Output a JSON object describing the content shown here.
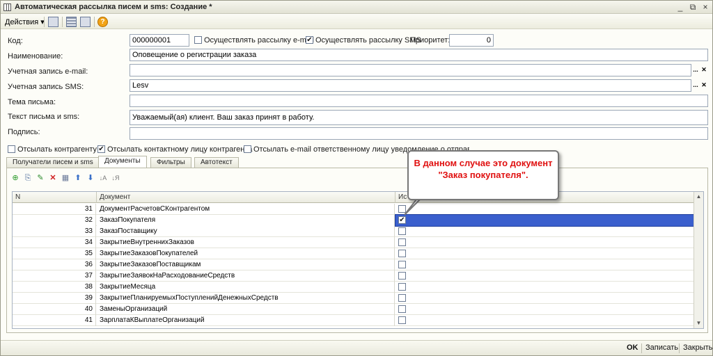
{
  "window": {
    "title": "Автоматическая рассылка писем и sms: Создание *",
    "controls": {
      "minimize": "_",
      "restore": "⧉",
      "close": "×"
    }
  },
  "toolbar": {
    "actions_label": "Действия",
    "icons": [
      "save-icon",
      "list-icon",
      "copy-icon",
      "help-icon"
    ]
  },
  "form": {
    "code_label": "Код:",
    "code_value": "000000001",
    "send_email_label": "Осуществлять рассылку e-mail",
    "send_email_checked": false,
    "send_sms_label": "Осуществлять рассылку SMS",
    "send_sms_checked": true,
    "priority_label": "Приоритет:",
    "priority_value": "0",
    "name_label": "Наименование:",
    "name_value": "Оповещение о регистрации заказа",
    "email_account_label": "Учетная запись e-mail:",
    "email_account_value": "",
    "sms_account_label": "Учетная запись SMS:",
    "sms_account_value": "Lesv",
    "subject_label": "Тема письма:",
    "subject_value": "",
    "text_label": "Текст письма и sms:",
    "text_value": "Уважаемый(ая) клиент. Ваш заказ принят в работу.",
    "signature_label": "Подпись:",
    "signature_value": "",
    "send_to_contractor_label": "Отсылать контрагенту",
    "send_to_contractor_checked": false,
    "send_to_contact_label": "Отсылать контактному лицу контрагента",
    "send_to_contact_checked": true,
    "send_to_responsible_label": "Отсылать e-mail ответственному лицу уведомление о отправленных"
  },
  "tabs": [
    {
      "label": "Получатели писем и sms",
      "active": false
    },
    {
      "label": "Документы",
      "active": true
    },
    {
      "label": "Фильтры",
      "active": false
    },
    {
      "label": "Автотекст",
      "active": false
    }
  ],
  "table": {
    "columns": [
      "N",
      "Документ",
      "Ис"
    ],
    "rows": [
      {
        "n": "31",
        "doc": "ДокументРасчетовСКонтрагентом",
        "use": false
      },
      {
        "n": "32",
        "doc": "ЗаказПокупателя",
        "use": true
      },
      {
        "n": "33",
        "doc": "ЗаказПоставщику",
        "use": false
      },
      {
        "n": "34",
        "doc": "ЗакрытиеВнутреннихЗаказов",
        "use": false
      },
      {
        "n": "35",
        "doc": "ЗакрытиеЗаказовПокупателей",
        "use": false
      },
      {
        "n": "36",
        "doc": "ЗакрытиеЗаказовПоставщикам",
        "use": false
      },
      {
        "n": "37",
        "doc": "ЗакрытиеЗаявокНаРасходованиеСредств",
        "use": false
      },
      {
        "n": "38",
        "doc": "ЗакрытиеМесяца",
        "use": false
      },
      {
        "n": "39",
        "doc": "ЗакрытиеПланируемыхПоступленийДенежныхСредств",
        "use": false
      },
      {
        "n": "40",
        "doc": "ЗаменыОрганизаций",
        "use": false
      },
      {
        "n": "41",
        "doc": "ЗарплатаКВыплатеОрганизаций",
        "use": false
      }
    ],
    "selected_row": 1
  },
  "callout": {
    "text": "В данном случае это документ \"Заказ покупателя\".",
    "color": "#e01010"
  },
  "buttons": {
    "ok": "OK",
    "save": "Записать",
    "close": "Закрыть"
  }
}
